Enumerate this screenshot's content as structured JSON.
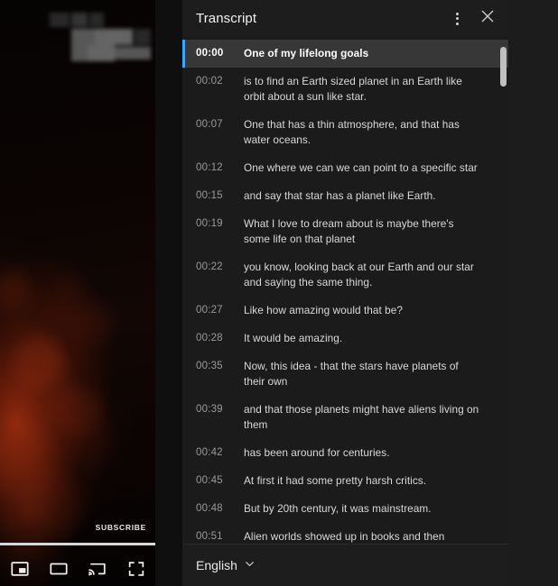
{
  "player": {
    "subscribe_label": "SUBSCRIBE",
    "title_overlay": "redacted-blurred-title",
    "progress_percent": 100,
    "controls": [
      {
        "name": "miniplayer-button",
        "icon": "miniplayer-icon",
        "label": "Miniplayer"
      },
      {
        "name": "theater-mode-button",
        "icon": "theater-mode-icon",
        "label": "Theater mode"
      },
      {
        "name": "cast-button",
        "icon": "cast-icon",
        "label": "Play on TV"
      },
      {
        "name": "fullscreen-button",
        "icon": "fullscreen-icon",
        "label": "Full screen"
      }
    ]
  },
  "transcript": {
    "header": {
      "title": "Transcript",
      "menu_icon": "more-options-icon",
      "close_icon": "close-icon"
    },
    "active_index": 0,
    "entries": [
      {
        "time": "00:00",
        "text": "One of my lifelong goals"
      },
      {
        "time": "00:02",
        "text": "is to find an Earth sized planet in an Earth like orbit about a sun like star."
      },
      {
        "time": "00:07",
        "text": "One that has a thin atmosphere, and that has water oceans."
      },
      {
        "time": "00:12",
        "text": "One where we can we can point to a specific star"
      },
      {
        "time": "00:15",
        "text": "and say that star has a planet like Earth."
      },
      {
        "time": "00:19",
        "text": "What I love to dream about is maybe there's some life on that planet"
      },
      {
        "time": "00:22",
        "text": "you know, looking back at our Earth and our star and saying the same thing."
      },
      {
        "time": "00:27",
        "text": "Like how amazing would that be?"
      },
      {
        "time": "00:28",
        "text": "It would be amazing."
      },
      {
        "time": "00:35",
        "text": "Now, this idea - that the stars have planets of their own"
      },
      {
        "time": "00:39",
        "text": "and that those planets might have aliens living on them"
      },
      {
        "time": "00:42",
        "text": "has been around for centuries."
      },
      {
        "time": "00:45",
        "text": "At first it had some pretty harsh critics."
      },
      {
        "time": "00:48",
        "text": "But by 20th century, it was mainstream."
      },
      {
        "time": "00:51",
        "text": "Alien worlds showed up in books and then movies and TV."
      }
    ],
    "footer": {
      "language": "English",
      "chevron_icon": "chevron-down-icon"
    }
  },
  "colors": {
    "accent": "#3ea6ff",
    "panel_bg": "#1b1b1b",
    "active_row_bg": "#373737",
    "text_primary": "#f1f1f1",
    "text_secondary": "#9a9a9a"
  }
}
